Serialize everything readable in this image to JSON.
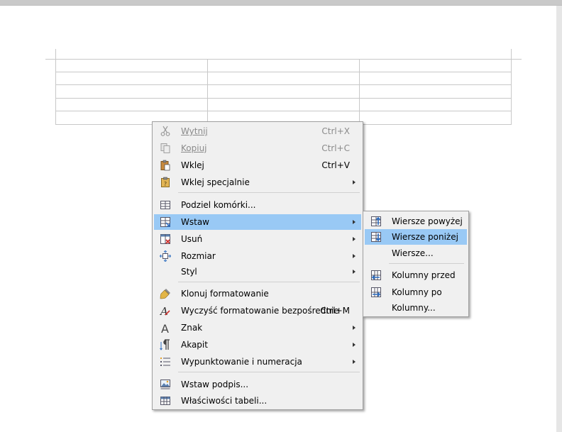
{
  "menu": {
    "items": [
      {
        "label": "Wytnij",
        "shortcut": "Ctrl+X",
        "icon": "scissors-icon",
        "disabled": true
      },
      {
        "label": "Kopiuj",
        "shortcut": "Ctrl+C",
        "icon": "copy-icon",
        "disabled": true
      },
      {
        "label": "Wklej",
        "shortcut": "Ctrl+V",
        "icon": "paste-icon"
      },
      {
        "label": "Wklej specjalnie",
        "icon": "paste-special-icon",
        "submenu": true
      },
      {
        "label": "Podziel komórki...",
        "icon": "split-cells-icon"
      },
      {
        "label": "Wstaw",
        "icon": "insert-table-icon",
        "submenu": true,
        "highlighted": true
      },
      {
        "label": "Usuń",
        "icon": "delete-table-icon",
        "submenu": true
      },
      {
        "label": "Rozmiar",
        "icon": "size-icon",
        "submenu": true
      },
      {
        "label": "Styl",
        "submenu": true
      },
      {
        "label": "Klonuj formatowanie",
        "icon": "clone-formatting-brush-icon"
      },
      {
        "label": "Wyczyść formatowanie bezpośrednie",
        "shortcut": "Ctrl+M",
        "icon": "clear-formatting-icon"
      },
      {
        "label": "Znak",
        "icon": "character-icon",
        "submenu": true
      },
      {
        "label": "Akapit",
        "icon": "paragraph-icon",
        "submenu": true
      },
      {
        "label": "Wypunktowanie i numeracja",
        "icon": "bullets-numbering-icon",
        "submenu": true
      },
      {
        "label": "Wstaw podpis...",
        "icon": "insert-caption-icon"
      },
      {
        "label": "Właściwości tabeli...",
        "icon": "table-properties-icon"
      }
    ]
  },
  "submenu": {
    "items": [
      {
        "label": "Wiersze powyżej",
        "icon": "insert-rows-above-icon"
      },
      {
        "label": "Wiersze poniżej",
        "icon": "insert-rows-below-icon",
        "highlighted": true
      },
      {
        "label": "Wiersze..."
      },
      {
        "label": "Kolumny przed",
        "icon": "insert-columns-before-icon"
      },
      {
        "label": "Kolumny po",
        "icon": "insert-columns-after-icon"
      },
      {
        "label": "Kolumny..."
      }
    ]
  },
  "colors": {
    "highlight": "#99c9f5",
    "menu_bg": "#f0f0f0",
    "table_border": "#c8c8c8"
  }
}
